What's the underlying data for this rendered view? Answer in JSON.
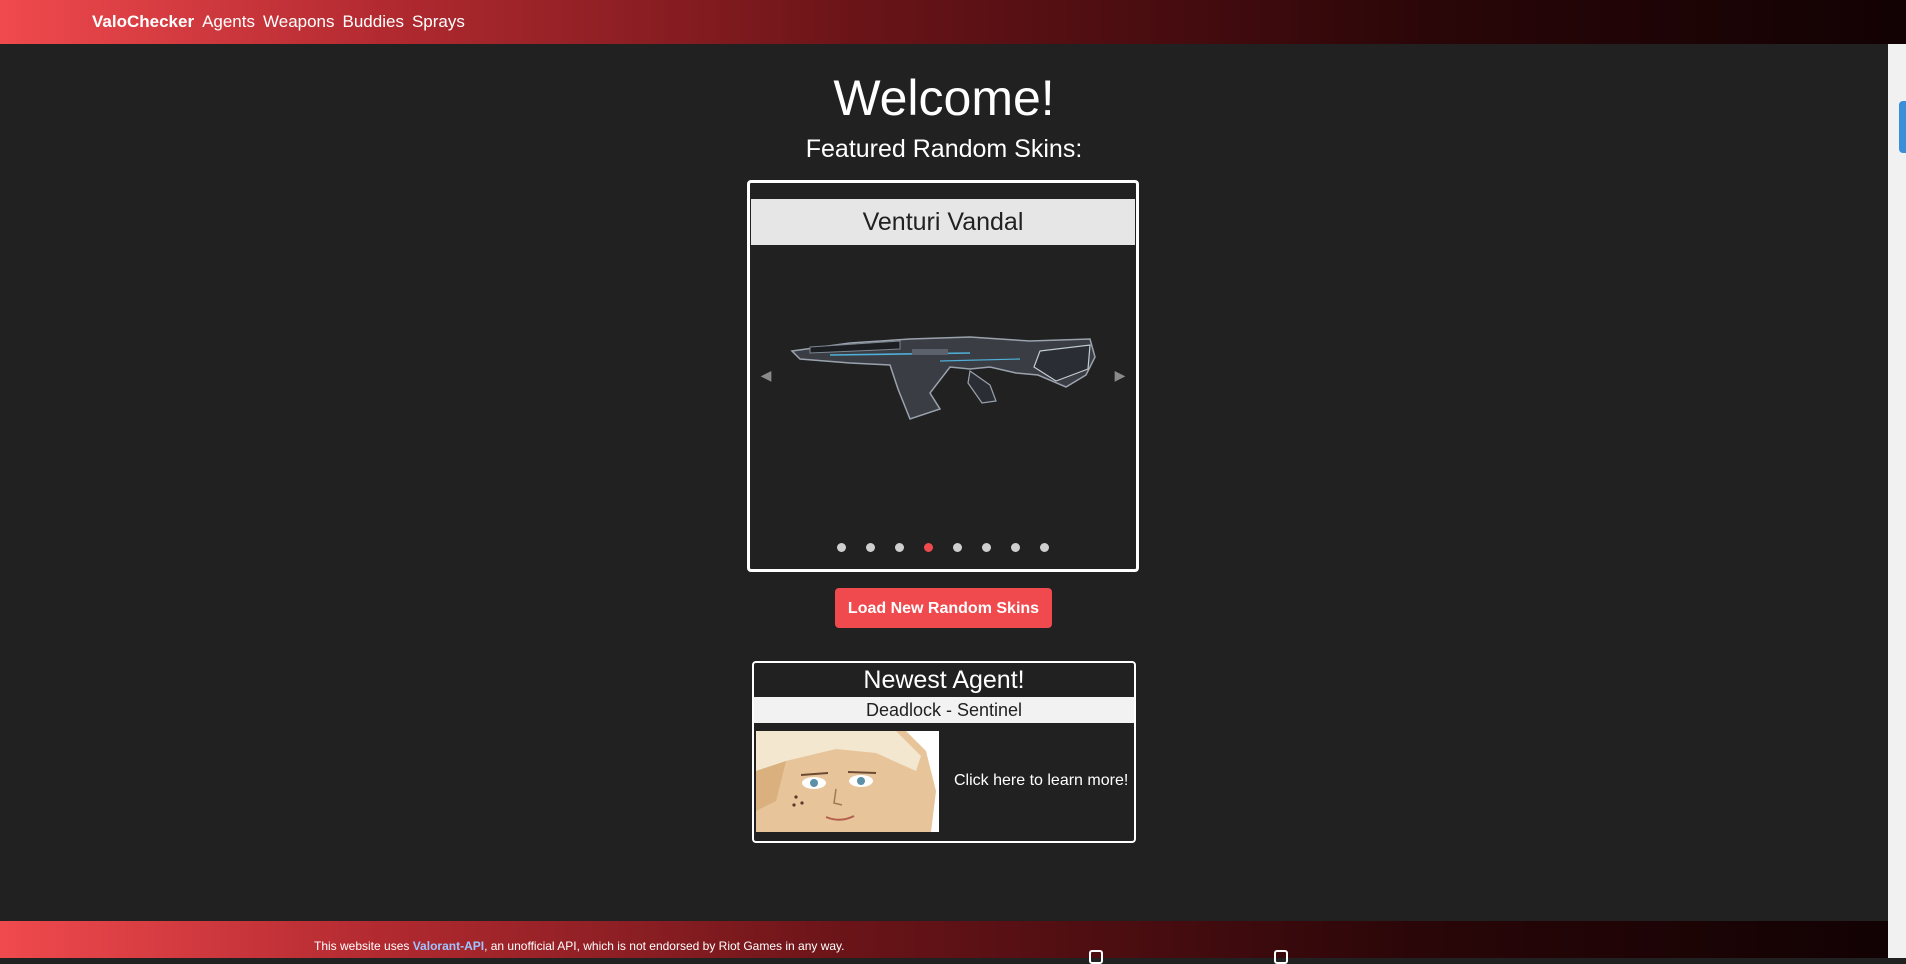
{
  "nav": {
    "brand": "ValoChecker",
    "links": [
      "Agents",
      "Weapons",
      "Buddies",
      "Sprays"
    ]
  },
  "hero": {
    "title": "Welcome!",
    "subtitle": "Featured Random Skins:"
  },
  "carousel": {
    "current_skin": "Venturi Vandal",
    "slide_count": 8,
    "active_index": 3,
    "accent": "#f04a4e"
  },
  "load_button": {
    "label": "Load New Random Skins"
  },
  "newest_agent": {
    "heading": "Newest Agent!",
    "name": "Deadlock - Sentinel",
    "link": "Click here to learn more!"
  },
  "footer": {
    "note_prefix": "This website uses ",
    "api_link": "Valorant-API",
    "note_suffix": ", an unofficial API, which is not endorsed by Riot Games in any way."
  },
  "colors": {
    "background": "#212121",
    "accent": "#f04a4e",
    "gradient_end": "#120203"
  }
}
